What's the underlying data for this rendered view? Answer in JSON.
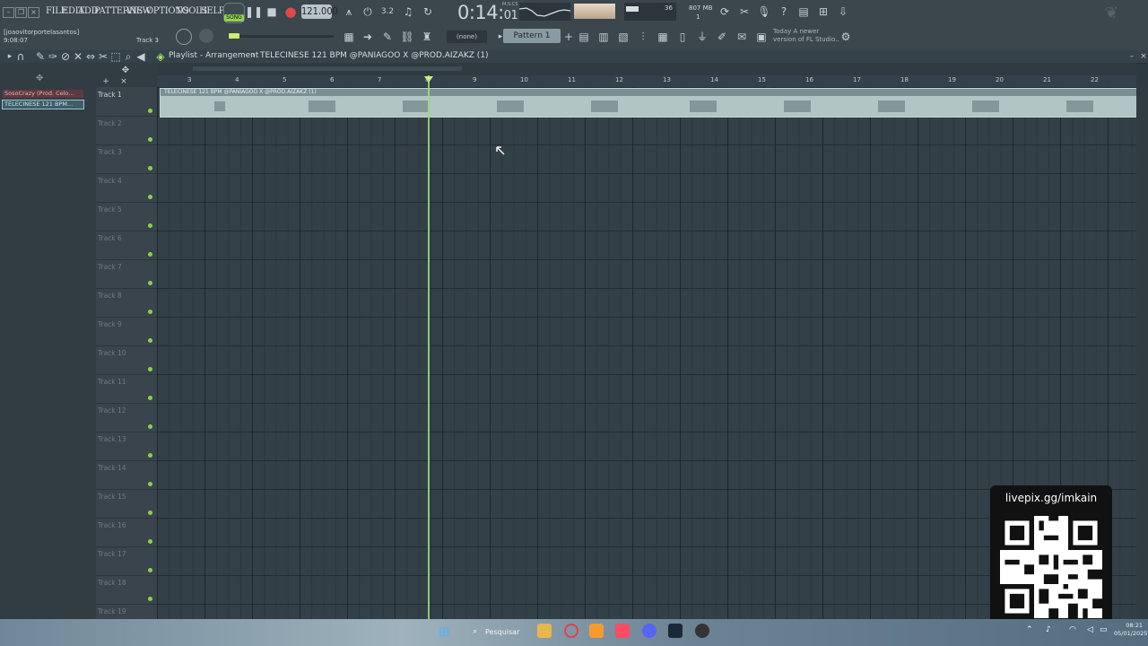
{
  "menu": [
    "FILE",
    "EDIT",
    "ADD",
    "PATTERNS",
    "VIEW",
    "OPTIONS",
    "TOOLS",
    "HELP"
  ],
  "transport": {
    "song_label": "SONG",
    "tempo": "121.000",
    "time_main": "0:14:",
    "time_frac": "01",
    "time_unit": "M:S:CS"
  },
  "stats": {
    "voices": "36",
    "memory": "807 MB",
    "cpu_count": "1"
  },
  "user": {
    "name": "[joaovitorportelasantos]",
    "time": "9:08:07",
    "hint": "Track 3"
  },
  "pattern_selector": {
    "none_label": "(none)",
    "pattern_label": "Pattern 1"
  },
  "news": {
    "line1_prefix": "Today",
    "line1": "A newer",
    "line2": "version of FL Studio.."
  },
  "playlist": {
    "title": "Playlist - Arrangement",
    "separator": "›",
    "clip_name": "TELECINESE 121 BPM @PANIAGOO X @PROD.AIZAKZ (1)"
  },
  "picker": [
    {
      "label": "SosoCrazy (Prod. Celo..."
    },
    {
      "label": "TELECINESE 121 BPM..."
    }
  ],
  "ruler": [
    "3",
    "4",
    "5",
    "6",
    "7",
    "8",
    "9",
    "10",
    "11",
    "12",
    "13",
    "14",
    "15",
    "16",
    "17",
    "18",
    "19",
    "20",
    "21",
    "22"
  ],
  "tracks": [
    "Track 1",
    "Track 2",
    "Track 3",
    "Track 4",
    "Track 5",
    "Track 6",
    "Track 7",
    "Track 8",
    "Track 9",
    "Track 10",
    "Track 11",
    "Track 12",
    "Track 13",
    "Track 14",
    "Track 15",
    "Track 16",
    "Track 17",
    "Track 18",
    "Track 19"
  ],
  "clip_label": "TELECINESE 121 BPM @PANIAGOO X @PROD.AIZAKZ (1)",
  "overlay": {
    "text": "livepix.gg/imkain"
  },
  "taskbar": {
    "search": "Pesquisar",
    "time": "08:21",
    "date": "05/01/2025"
  }
}
